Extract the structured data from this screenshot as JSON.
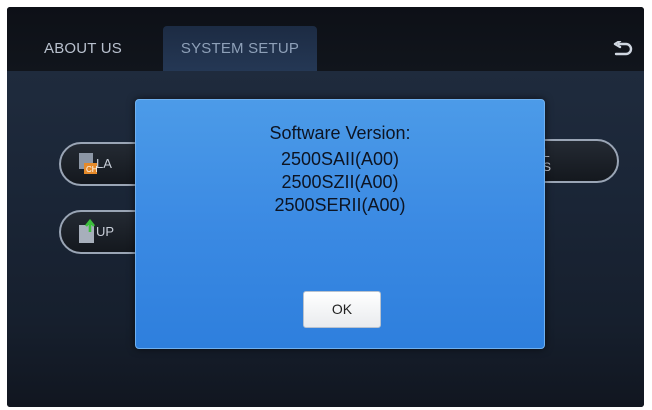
{
  "tabs": [
    {
      "label": "ABOUT US",
      "active": false
    },
    {
      "label": "SYSTEM SETUP",
      "active": true
    }
  ],
  "icons": {
    "back": "back-arrow-icon",
    "language": "language-icon",
    "update": "update-icon"
  },
  "menu": {
    "language_label": "LA",
    "update_label": "UP",
    "manual_label_line1": "AL",
    "manual_label_line2": "KS"
  },
  "dialog": {
    "title": "Software Version:",
    "versions": [
      "2500SAII(A00)",
      "2500SZII(A00)",
      "2500SERII(A00)"
    ],
    "ok_label": "OK"
  },
  "colors": {
    "dialog_bg": "#3b8ae3",
    "active_tab_bg": "#253855",
    "screen_bg": "#0c0e13"
  }
}
